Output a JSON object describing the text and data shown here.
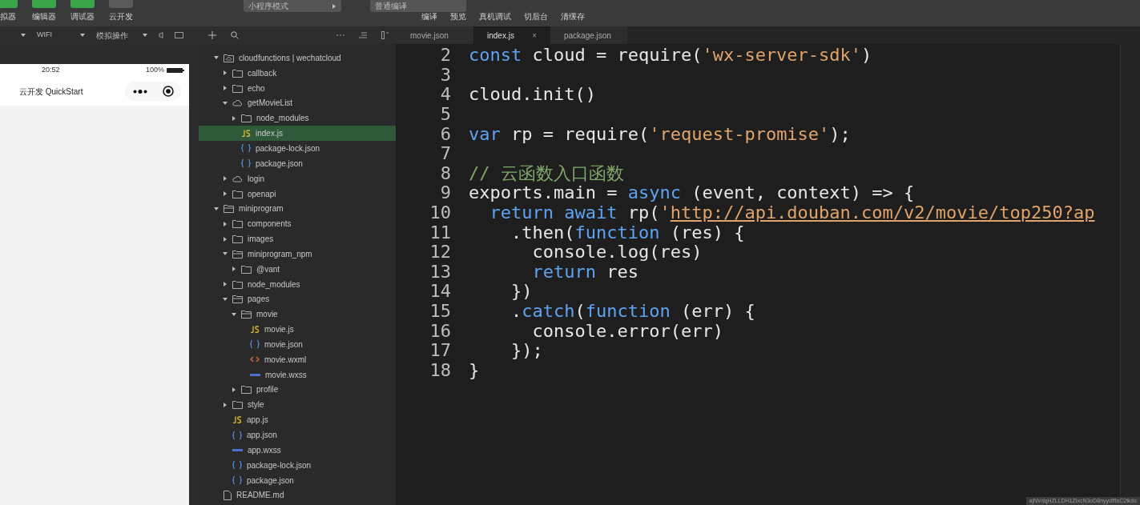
{
  "toolbar": {
    "left_buttons": [
      {
        "label": "拟器",
        "color": "#3aa548"
      },
      {
        "label": "编辑器",
        "color": "#3aa548"
      },
      {
        "label": "调试器",
        "color": "#3aa548"
      },
      {
        "label": "云开发",
        "color": "#5a5a5a"
      }
    ],
    "mode_select": {
      "value": "小程序模式"
    },
    "compile_select": {
      "value": "普通编译"
    },
    "actions": [
      "编译",
      "预览",
      "真机调试",
      "切后台",
      "清缓存"
    ]
  },
  "sim_bar": {
    "network": "WIFI",
    "operate": "模拟操作"
  },
  "phone": {
    "time": "20:52",
    "battery": "100%",
    "title": "云开发 QuickStart"
  },
  "tree": [
    {
      "name": "cloudfunctions | wechatcloud",
      "kind": "cloudroot",
      "expanded": true,
      "selected": false,
      "children": [
        {
          "name": "callback",
          "kind": "folder",
          "expanded": false,
          "selected": false
        },
        {
          "name": "echo",
          "kind": "folder",
          "expanded": false,
          "selected": false
        },
        {
          "name": "getMovieList",
          "kind": "cloud",
          "expanded": true,
          "selected": false,
          "children": [
            {
              "name": "node_modules",
              "kind": "folder",
              "expanded": false,
              "selected": false
            },
            {
              "name": "index.js",
              "kind": "js",
              "selected": true
            },
            {
              "name": "package-lock.json",
              "kind": "json",
              "selected": false
            },
            {
              "name": "package.json",
              "kind": "json",
              "selected": false
            }
          ]
        },
        {
          "name": "login",
          "kind": "cloud",
          "expanded": false,
          "selected": false
        },
        {
          "name": "openapi",
          "kind": "folder",
          "expanded": false,
          "selected": false
        }
      ]
    },
    {
      "name": "miniprogram",
      "kind": "folder",
      "expanded": true,
      "selected": false,
      "children": [
        {
          "name": "components",
          "kind": "folder",
          "expanded": false,
          "selected": false
        },
        {
          "name": "images",
          "kind": "folder",
          "expanded": false,
          "selected": false
        },
        {
          "name": "miniprogram_npm",
          "kind": "folder",
          "expanded": true,
          "selected": false,
          "children": [
            {
              "name": "@vant",
              "kind": "folder",
              "expanded": false,
              "selected": false
            }
          ]
        },
        {
          "name": "node_modules",
          "kind": "folder",
          "expanded": false,
          "selected": false
        },
        {
          "name": "pages",
          "kind": "folder",
          "expanded": true,
          "selected": false,
          "children": [
            {
              "name": "movie",
              "kind": "folder",
              "expanded": true,
              "selected": false,
              "children": [
                {
                  "name": "movie.js",
                  "kind": "js",
                  "selected": false
                },
                {
                  "name": "movie.json",
                  "kind": "json",
                  "selected": false
                },
                {
                  "name": "movie.wxml",
                  "kind": "wxml",
                  "selected": false
                },
                {
                  "name": "movie.wxss",
                  "kind": "wxss",
                  "selected": false
                }
              ]
            },
            {
              "name": "profile",
              "kind": "folder",
              "expanded": false,
              "selected": false
            }
          ]
        },
        {
          "name": "style",
          "kind": "folder",
          "expanded": false,
          "selected": false
        },
        {
          "name": "app.js",
          "kind": "js",
          "selected": false
        },
        {
          "name": "app.json",
          "kind": "json",
          "selected": false
        },
        {
          "name": "app.wxss",
          "kind": "wxss",
          "selected": false
        },
        {
          "name": "package-lock.json",
          "kind": "json",
          "selected": false
        },
        {
          "name": "package.json",
          "kind": "json",
          "selected": false
        }
      ]
    },
    {
      "name": "README.md",
      "kind": "file",
      "selected": false
    }
  ],
  "tabs": [
    {
      "label": "movie.json",
      "selected": false
    },
    {
      "label": "index.js",
      "selected": true
    },
    {
      "label": "package.json",
      "selected": false
    }
  ],
  "tab_close": "×",
  "code": [
    {
      "number": "2",
      "tokens": [
        {
          "kind": "keyword",
          "text": "const"
        },
        {
          "kind": "plain",
          "text": " cloud = require("
        },
        {
          "kind": "string",
          "text": "'wx-server-sdk'"
        },
        {
          "kind": "plain",
          "text": ")"
        }
      ]
    },
    {
      "number": "3"
    },
    {
      "number": "4",
      "tokens": [
        {
          "kind": "plain",
          "text": "cloud.init()"
        }
      ]
    },
    {
      "number": "5"
    },
    {
      "number": "6",
      "tokens": [
        {
          "kind": "keyword",
          "text": "var"
        },
        {
          "kind": "plain",
          "text": " rp = require("
        },
        {
          "kind": "string",
          "text": "'request-promise'"
        },
        {
          "kind": "plain",
          "text": ");"
        }
      ]
    },
    {
      "number": "7"
    },
    {
      "number": "8",
      "tokens": [
        {
          "kind": "comment",
          "text": "// 云函数入口函数"
        }
      ]
    },
    {
      "number": "9",
      "tokens": [
        {
          "kind": "plain",
          "text": "exports.main = "
        },
        {
          "kind": "keyword",
          "text": "async"
        },
        {
          "kind": "plain",
          "text": " (event, context) => {"
        }
      ]
    },
    {
      "number": "10",
      "tokens": [
        {
          "kind": "keyword",
          "text": "  return await"
        },
        {
          "kind": "plain",
          "text": " rp("
        },
        {
          "kind": "string",
          "text": "'"
        },
        {
          "kind": "link",
          "text": "http://api.douban.com/v2/movie/top250?ap"
        }
      ]
    },
    {
      "number": "11",
      "tokens": [
        {
          "kind": "plain",
          "text": "    .then("
        },
        {
          "kind": "keyword",
          "text": "function"
        },
        {
          "kind": "plain",
          "text": " (res) {"
        }
      ]
    },
    {
      "number": "12",
      "tokens": [
        {
          "kind": "plain",
          "text": "      console.log(res)"
        }
      ]
    },
    {
      "number": "13",
      "tokens": [
        {
          "kind": "keyword",
          "text": "      return"
        },
        {
          "kind": "plain",
          "text": " res"
        }
      ]
    },
    {
      "number": "14",
      "tokens": [
        {
          "kind": "plain",
          "text": "    })"
        }
      ]
    },
    {
      "number": "15",
      "tokens": [
        {
          "kind": "plain",
          "text": "    ."
        },
        {
          "kind": "keyword",
          "text": "catch"
        },
        {
          "kind": "plain",
          "text": "("
        },
        {
          "kind": "keyword",
          "text": "function"
        },
        {
          "kind": "plain",
          "text": " (err) {"
        }
      ]
    },
    {
      "number": "16",
      "tokens": [
        {
          "kind": "plain",
          "text": "      console.error(err)"
        }
      ]
    },
    {
      "number": "17",
      "tokens": [
        {
          "kind": "plain",
          "text": "    });"
        }
      ]
    },
    {
      "number": "18",
      "tokens": [
        {
          "kind": "plain",
          "text": "}"
        }
      ]
    }
  ],
  "status_text": "ajNVdqHZLLDH1ZlxcN3oD8nyydffIsC2tkdc"
}
